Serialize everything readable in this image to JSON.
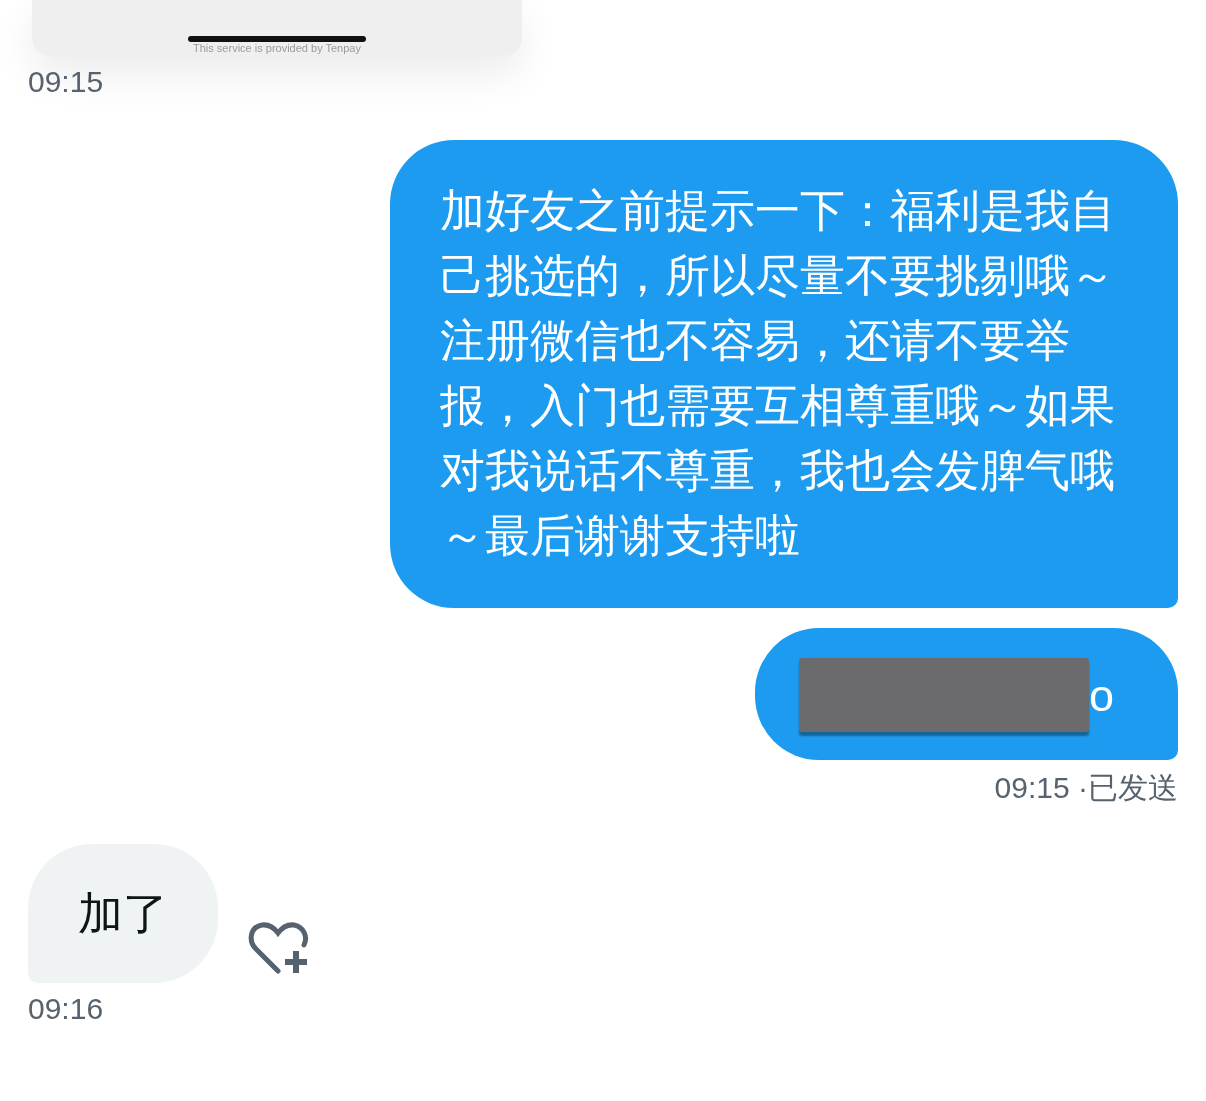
{
  "top_card": {
    "footer": "This service is provided by Tenpay",
    "time": "09:15"
  },
  "messages": [
    {
      "outgoing": true,
      "kind": "text",
      "text": "加好友之前提示一下：福利是我自己挑选的，所以尽量不要挑剔哦～注册微信也不容易，还请不要举报，入门也需要互相尊重哦～如果对我说话不尊重，我也会发脾气哦～最后谢谢支持啦"
    },
    {
      "outgoing": true,
      "kind": "redacted",
      "text": "o",
      "meta": "09:15 ·已发送"
    },
    {
      "outgoing": false,
      "kind": "text",
      "text": "加了",
      "meta": "09:16",
      "reaction_button": true
    }
  ]
}
